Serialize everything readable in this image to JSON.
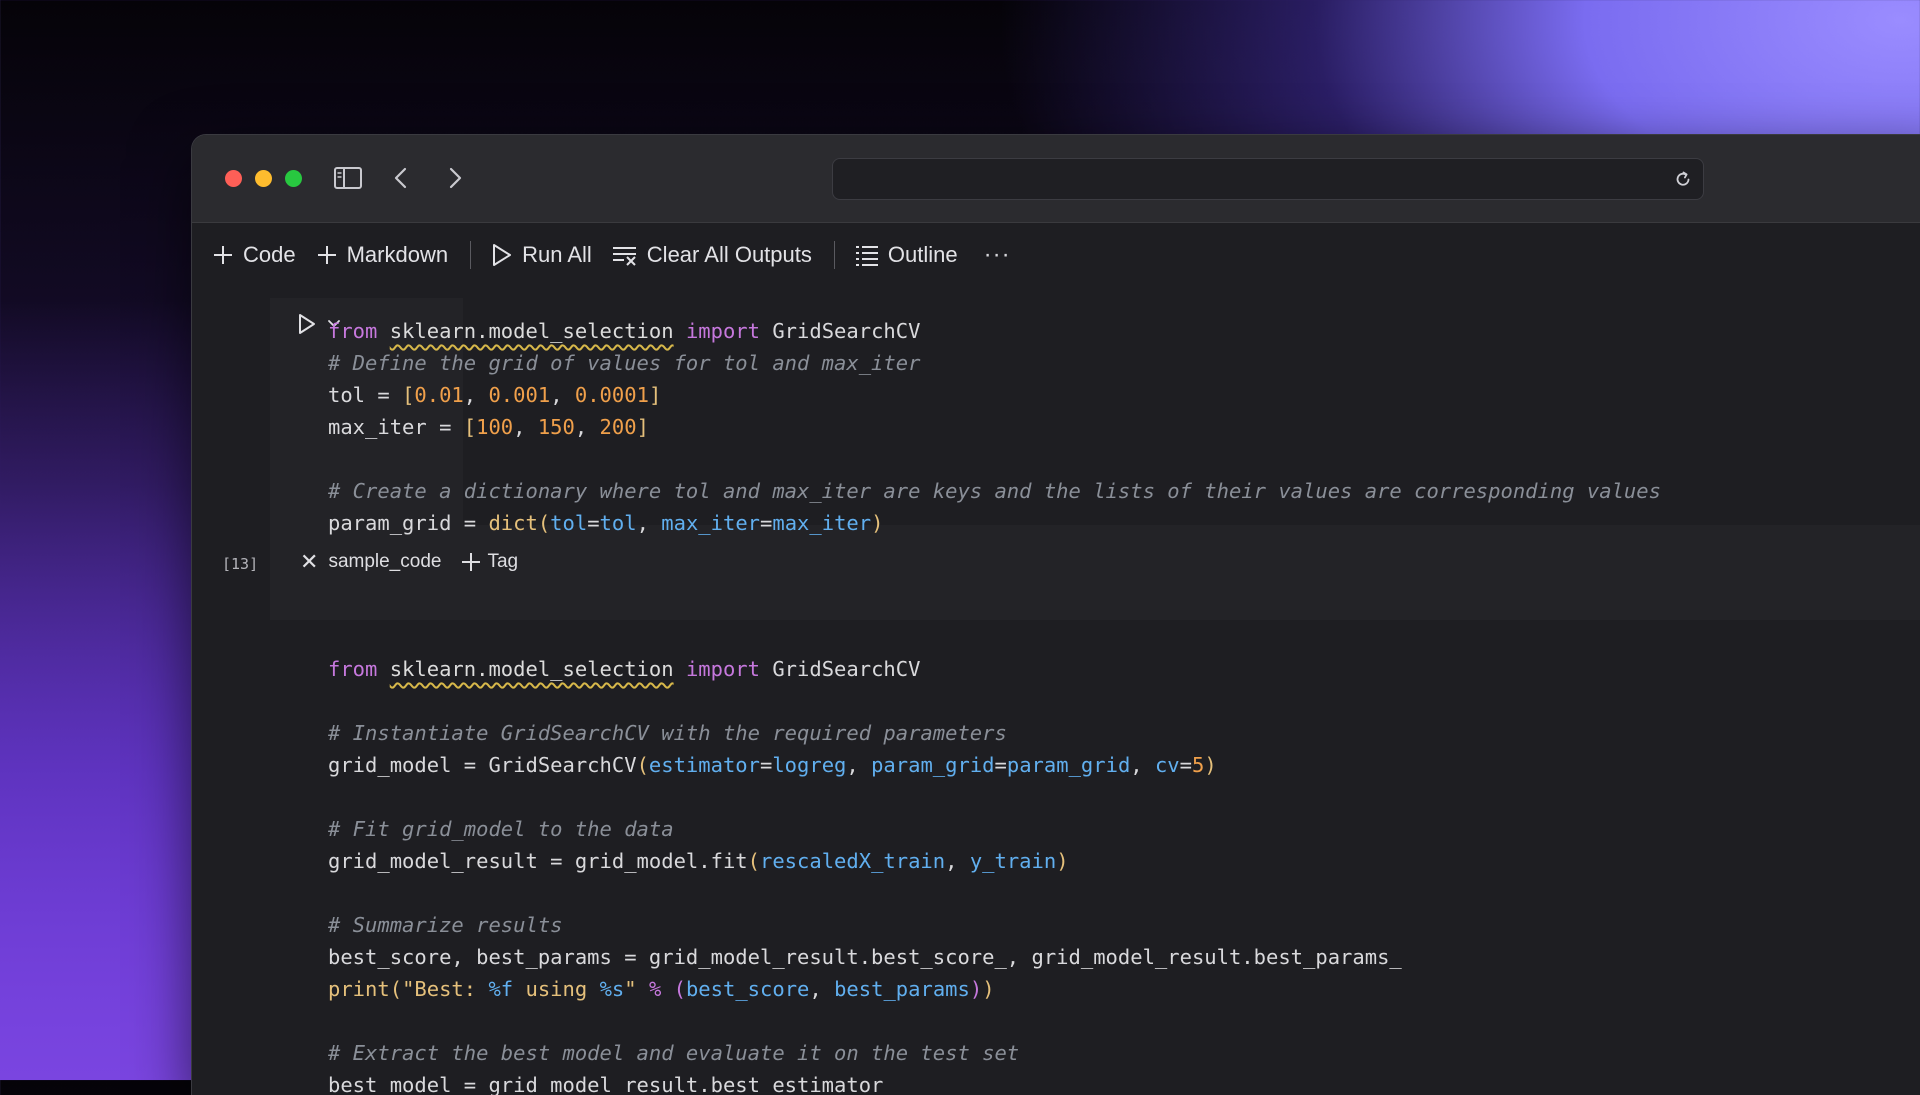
{
  "toolbar": {
    "code_label": "Code",
    "markdown_label": "Markdown",
    "run_all_label": "Run All",
    "clear_outputs_label": "Clear All Outputs",
    "outline_label": "Outline",
    "more_label": "···"
  },
  "cell1": {
    "execution_count": "[13]",
    "tag_name": "sample_code",
    "add_tag_label": "Tag",
    "lines": [
      "from sklearn.model_selection import GridSearchCV",
      "# Define the grid of values for tol and max_iter",
      "tol = [0.01, 0.001, 0.0001]",
      "max_iter = [100, 150, 200]",
      "",
      "# Create a dictionary where tol and max_iter are keys and the lists of their values are corresponding values",
      "param_grid = dict(tol=tol, max_iter=max_iter)"
    ]
  },
  "cell2": {
    "lines": [
      "from sklearn.model_selection import GridSearchCV",
      "",
      "# Instantiate GridSearchCV with the required parameters",
      "grid_model = GridSearchCV(estimator=logreg, param_grid=param_grid, cv=5)",
      "",
      "# Fit grid_model to the data",
      "grid_model_result = grid_model.fit(rescaledX_train, y_train)",
      "",
      "# Summarize results",
      "best_score, best_params = grid_model_result.best_score_, grid_model_result.best_params_",
      "print(\"Best: %f using %s\" % (best_score, best_params))",
      "",
      "# Extract the best model and evaluate it on the test set",
      "best_model = grid_model_result.best_estimator_"
    ]
  },
  "colors": {
    "keyword": "#c678dd",
    "comment": "#8a8f98",
    "number": "#f0a04b",
    "parameter": "#61afef",
    "function": "#e5c07b"
  }
}
